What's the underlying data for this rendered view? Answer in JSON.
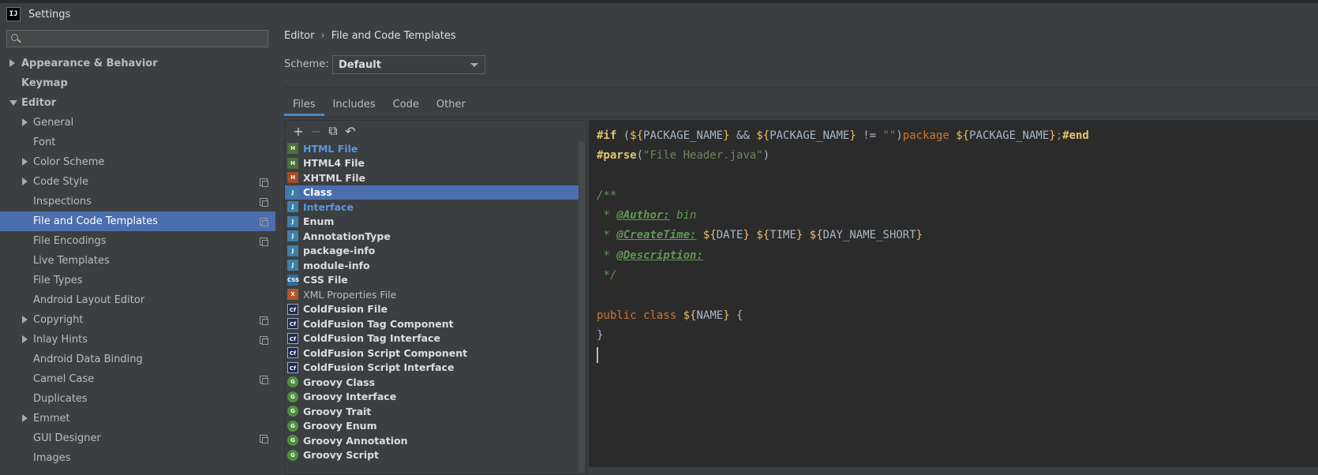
{
  "window": {
    "title": "Settings",
    "app_icon": "IJ"
  },
  "search": {
    "placeholder": ""
  },
  "sidebar": {
    "items": [
      {
        "label": "Appearance & Behavior",
        "level": 0,
        "bold": true,
        "expander": "right",
        "copy": false
      },
      {
        "label": "Keymap",
        "level": 0,
        "bold": true,
        "expander": "none",
        "copy": false
      },
      {
        "label": "Editor",
        "level": 0,
        "bold": true,
        "expander": "down",
        "copy": false
      },
      {
        "label": "General",
        "level": 1,
        "expander": "right",
        "copy": false
      },
      {
        "label": "Font",
        "level": 1,
        "expander": "none",
        "copy": false
      },
      {
        "label": "Color Scheme",
        "level": 1,
        "expander": "right",
        "copy": false
      },
      {
        "label": "Code Style",
        "level": 1,
        "expander": "right",
        "copy": true
      },
      {
        "label": "Inspections",
        "level": 1,
        "expander": "none",
        "copy": true
      },
      {
        "label": "File and Code Templates",
        "level": 1,
        "expander": "none",
        "copy": true,
        "selected": true
      },
      {
        "label": "File Encodings",
        "level": 1,
        "expander": "none",
        "copy": true
      },
      {
        "label": "Live Templates",
        "level": 1,
        "expander": "none",
        "copy": false
      },
      {
        "label": "File Types",
        "level": 1,
        "expander": "none",
        "copy": false
      },
      {
        "label": "Android Layout Editor",
        "level": 1,
        "expander": "none",
        "copy": false
      },
      {
        "label": "Copyright",
        "level": 1,
        "expander": "right",
        "copy": true
      },
      {
        "label": "Inlay Hints",
        "level": 1,
        "expander": "right",
        "copy": true
      },
      {
        "label": "Android Data Binding",
        "level": 1,
        "expander": "none",
        "copy": false
      },
      {
        "label": "Camel Case",
        "level": 1,
        "expander": "none",
        "copy": true
      },
      {
        "label": "Duplicates",
        "level": 1,
        "expander": "none",
        "copy": false
      },
      {
        "label": "Emmet",
        "level": 1,
        "expander": "right",
        "copy": false
      },
      {
        "label": "GUI Designer",
        "level": 1,
        "expander": "none",
        "copy": true
      },
      {
        "label": "Images",
        "level": 1,
        "expander": "none",
        "copy": false
      }
    ]
  },
  "breadcrumb": {
    "parent": "Editor",
    "separator": "›",
    "current": "File and Code Templates"
  },
  "scheme": {
    "label": "Scheme:",
    "value": "Default"
  },
  "tabs": [
    {
      "label": "Files",
      "active": true
    },
    {
      "label": "Includes",
      "active": false
    },
    {
      "label": "Code",
      "active": false
    },
    {
      "label": "Other",
      "active": false
    }
  ],
  "toolbar": {
    "add": "+",
    "remove": "−",
    "copy": "⧉",
    "reset": "↶"
  },
  "templates": [
    {
      "label": "HTML File",
      "icon": "html",
      "badge": "H",
      "style": "blue"
    },
    {
      "label": "HTML4 File",
      "icon": "html",
      "badge": "H",
      "style": "bold"
    },
    {
      "label": "XHTML File",
      "icon": "xhtml",
      "badge": "H",
      "style": "bold"
    },
    {
      "label": "Class",
      "icon": "java",
      "badge": "J",
      "style": "bold",
      "selected": true
    },
    {
      "label": "Interface",
      "icon": "java",
      "badge": "J",
      "style": "blue"
    },
    {
      "label": "Enum",
      "icon": "java",
      "badge": "J",
      "style": "bold"
    },
    {
      "label": "AnnotationType",
      "icon": "java",
      "badge": "J",
      "style": "bold"
    },
    {
      "label": "package-info",
      "icon": "java",
      "badge": "J",
      "style": "bold"
    },
    {
      "label": "module-info",
      "icon": "java",
      "badge": "J",
      "style": "bold"
    },
    {
      "label": "CSS File",
      "icon": "css",
      "badge": "CSS",
      "style": "bold"
    },
    {
      "label": "XML Properties File",
      "icon": "xml",
      "badge": "X",
      "style": "normal"
    },
    {
      "label": "ColdFusion File",
      "icon": "cf",
      "badge": "Cf",
      "style": "bold"
    },
    {
      "label": "ColdFusion Tag Component",
      "icon": "cf",
      "badge": "Cf",
      "style": "bold"
    },
    {
      "label": "ColdFusion Tag Interface",
      "icon": "cf",
      "badge": "Cf",
      "style": "bold"
    },
    {
      "label": "ColdFusion Script Component",
      "icon": "cf",
      "badge": "Cf",
      "style": "bold"
    },
    {
      "label": "ColdFusion Script Interface",
      "icon": "cf",
      "badge": "Cf",
      "style": "bold"
    },
    {
      "label": "Groovy Class",
      "icon": "groovy",
      "badge": "G",
      "style": "bold"
    },
    {
      "label": "Groovy Interface",
      "icon": "groovy",
      "badge": "G",
      "style": "bold"
    },
    {
      "label": "Groovy Trait",
      "icon": "groovy",
      "badge": "G",
      "style": "bold"
    },
    {
      "label": "Groovy Enum",
      "icon": "groovy",
      "badge": "G",
      "style": "bold"
    },
    {
      "label": "Groovy Annotation",
      "icon": "groovy",
      "badge": "G",
      "style": "bold"
    },
    {
      "label": "Groovy Script",
      "icon": "groovy",
      "badge": "G",
      "style": "bold"
    }
  ],
  "editor": {
    "lines": [
      [
        [
          "dir",
          "#if"
        ],
        [
          "plain",
          " ("
        ],
        [
          "var",
          "${"
        ],
        [
          "vname",
          "PACKAGE_NAME"
        ],
        [
          "var",
          "}"
        ],
        [
          "plain",
          " && "
        ],
        [
          "var",
          "${"
        ],
        [
          "vname",
          "PACKAGE_NAME"
        ],
        [
          "var",
          "}"
        ],
        [
          "plain",
          " != "
        ],
        [
          "str",
          "\"\""
        ],
        [
          "plain",
          ")"
        ],
        [
          "kw",
          "package"
        ],
        [
          "plain",
          " "
        ],
        [
          "var",
          "${"
        ],
        [
          "vname",
          "PACKAGE_NAME"
        ],
        [
          "var",
          "}"
        ],
        [
          "kw",
          ";"
        ],
        [
          "dir",
          "#end"
        ]
      ],
      [
        [
          "dir",
          "#parse"
        ],
        [
          "plain",
          "("
        ],
        [
          "str",
          "\"File Header.java\""
        ],
        [
          "plain",
          ")"
        ]
      ],
      [],
      [
        [
          "cmt",
          "/**"
        ]
      ],
      [
        [
          "cmt",
          " * "
        ],
        [
          "tag",
          "@Author:"
        ],
        [
          "cmt",
          " bin"
        ]
      ],
      [
        [
          "cmt",
          " * "
        ],
        [
          "tag",
          "@CreateTime:"
        ],
        [
          "plain",
          " "
        ],
        [
          "var",
          "${"
        ],
        [
          "vname",
          "DATE"
        ],
        [
          "var",
          "}"
        ],
        [
          "plain",
          " "
        ],
        [
          "var",
          "${"
        ],
        [
          "vname",
          "TIME"
        ],
        [
          "var",
          "}"
        ],
        [
          "plain",
          " "
        ],
        [
          "var",
          "${"
        ],
        [
          "vname",
          "DAY_NAME_SHORT"
        ],
        [
          "var",
          "}"
        ]
      ],
      [
        [
          "cmt",
          " * "
        ],
        [
          "tag",
          "@Description:"
        ]
      ],
      [
        [
          "cmt",
          " */"
        ]
      ],
      [],
      [
        [
          "kw",
          "public"
        ],
        [
          "plain",
          " "
        ],
        [
          "kw",
          "class"
        ],
        [
          "plain",
          " "
        ],
        [
          "var",
          "${"
        ],
        [
          "vname",
          "NAME"
        ],
        [
          "var",
          "}"
        ],
        [
          "plain",
          " {"
        ]
      ],
      [
        [
          "plain",
          "}"
        ]
      ],
      [
        [
          "caret",
          ""
        ]
      ]
    ]
  },
  "colors": {
    "selection": "#4b6eaf",
    "background": "#3c3f41",
    "editor_bg": "#2b2b2b",
    "link_blue": "#5896e0"
  }
}
